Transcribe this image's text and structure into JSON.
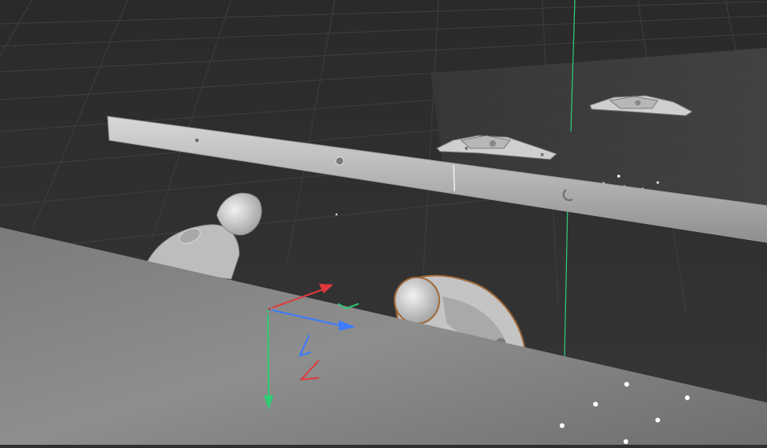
{
  "viewport": {
    "name": "3d-viewport",
    "colors": {
      "background": "#2f2f2f",
      "grid": "#3c3c3c",
      "y_axis_line": "#2fd07a",
      "gizmo_x": "#e0393b",
      "gizmo_y": "#2ecc71",
      "gizmo_z": "#3a7bff",
      "part_edge": "#a06a3a",
      "panel": "#8a8a8a"
    },
    "icons": {
      "gizmo": "transform-gizmo-icon"
    }
  }
}
